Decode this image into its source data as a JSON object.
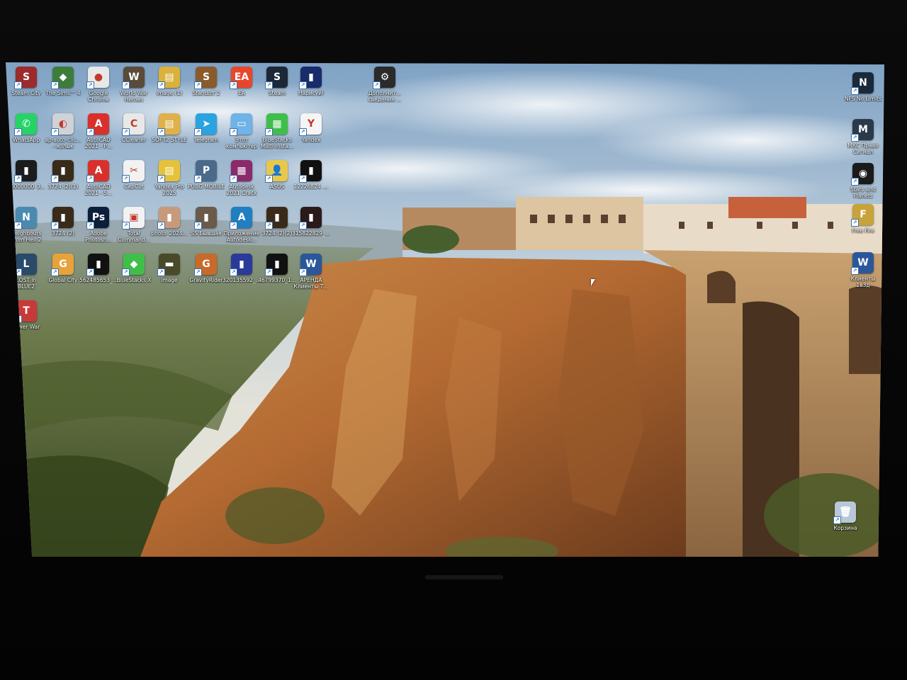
{
  "desktop": {
    "left_icons": [
      {
        "label": "Steam City",
        "color": "#9c2b2b",
        "glyph": "S"
      },
      {
        "label": "The Sims™ 4",
        "color": "#3d7d3b",
        "glyph": "◆"
      },
      {
        "label": "Google Chrome",
        "color": "#e8e8e8",
        "glyph": "●"
      },
      {
        "label": "World War Heroes",
        "color": "#5a4a3a",
        "glyph": "W"
      },
      {
        "label": "image (1)",
        "color": "#d9b13b",
        "glyph": "▤"
      },
      {
        "label": "Standoff 2",
        "color": "#8a5a2a",
        "glyph": "S"
      },
      {
        "label": "EA",
        "color": "#e8462b",
        "glyph": "EA"
      },
      {
        "label": "Steam",
        "color": "#1b2838",
        "glyph": "S"
      },
      {
        "label": "Нарисуй!",
        "color": "#1a2b6b",
        "glyph": "▮"
      },
      {
        "label": "WhatsApp",
        "color": "#25d366",
        "glyph": "✆"
      },
      {
        "label": "ap-auto-clic... - ярлык",
        "color": "#cfd3d6",
        "glyph": "◐"
      },
      {
        "label": "AutoCAD 2021 - Р...",
        "color": "#d9302b",
        "glyph": "A"
      },
      {
        "label": "CCleaner",
        "color": "#e8e8e8",
        "glyph": "C"
      },
      {
        "label": "SOFT2 STYLE",
        "color": "#e0b04a",
        "glyph": "▤"
      },
      {
        "label": "Telegram",
        "color": "#2aa3e0",
        "glyph": "➤"
      },
      {
        "label": "Этот компьютер",
        "color": "#6fb3e8",
        "glyph": "▭"
      },
      {
        "label": "BlueStacks Multi-Insta...",
        "color": "#3fbf4a",
        "glyph": "▦"
      },
      {
        "label": "Yandex",
        "color": "#f5f5f5",
        "glyph": "Y"
      },
      {
        "label": "10000000_3...",
        "color": "#1c1c1c",
        "glyph": "▮"
      },
      {
        "label": "3724 (2)(1)",
        "color": "#3a2a1a",
        "glyph": "▮"
      },
      {
        "label": "AutoCAD 2021 - S...",
        "color": "#d9302b",
        "glyph": "A"
      },
      {
        "label": "CapCut",
        "color": "#f2f2f2",
        "glyph": "✂"
      },
      {
        "label": "Yandex Pro 2025",
        "color": "#e6c23a",
        "glyph": "▤"
      },
      {
        "label": "PUBG MOBILE",
        "color": "#4a6a8a",
        "glyph": "P"
      },
      {
        "label": "Autodesk 2021 Crack",
        "color": "#8a2a6a",
        "glyph": "▦"
      },
      {
        "label": "ASUS",
        "color": "#e8c84a",
        "glyph": "👤"
      },
      {
        "label": "12226824_...",
        "color": "#111111",
        "glyph": "▮"
      },
      {
        "label": "Neighbours From Hell 2",
        "color": "#4a8ab0",
        "glyph": "N"
      },
      {
        "label": "3724 (2)",
        "color": "#3a2a1a",
        "glyph": "▮"
      },
      {
        "label": "Adobe Photosh...",
        "color": "#0b1f3a",
        "glyph": "Ps"
      },
      {
        "label": "Total Command...",
        "color": "#f2f2f2",
        "glyph": "▣"
      },
      {
        "label": "photo_2024...",
        "color": "#c89a7a",
        "glyph": "▮"
      },
      {
        "label": "SS Бывшая",
        "color": "#6a5a4a",
        "glyph": "▮"
      },
      {
        "label": "Приложение Autodesk...",
        "color": "#1f7fc0",
        "glyph": "A"
      },
      {
        "label": "3724 (2)(2)",
        "color": "#3a2a1a",
        "glyph": "▮"
      },
      {
        "label": "315822829_...",
        "color": "#2a1a1a",
        "glyph": "▮"
      },
      {
        "label": "LOST in BLUE2",
        "color": "#2a4a6a",
        "glyph": "L"
      },
      {
        "label": "Global City",
        "color": "#e8a23a",
        "glyph": "G"
      },
      {
        "label": "562485653_...",
        "color": "#111111",
        "glyph": "▮"
      },
      {
        "label": "BlueStacks X",
        "color": "#3fbf4a",
        "glyph": "◆"
      },
      {
        "label": "image",
        "color": "#4a4a2a",
        "glyph": "▬"
      },
      {
        "label": "GravityRider",
        "color": "#c86a2a",
        "glyph": "G"
      },
      {
        "label": "320135592_...",
        "color": "#2a3a9a",
        "glyph": "▮"
      },
      {
        "label": "46799370_1...",
        "color": "#111111",
        "glyph": "▮"
      },
      {
        "label": "АРЕНДА Клиенты Т...",
        "color": "#2b579a",
        "glyph": "W"
      },
      {
        "label": "Tower War",
        "color": "#c83a3a",
        "glyph": "T"
      }
    ],
    "middle_icon": {
      "label": "Дополнит... сведения ...",
      "color": "#2a2a2a",
      "glyph": "⚙"
    },
    "right_icons": [
      {
        "label": "NFS No Limits",
        "color": "#1a2a3a",
        "glyph": "N"
      },
      {
        "label": "МКС Право Сигнал",
        "color": "#2a3a4a",
        "glyph": "M"
      },
      {
        "label": "Stars and Planets",
        "color": "#1a1a1a",
        "glyph": "◉"
      },
      {
        "label": "Free Fire",
        "color": "#c8a23a",
        "glyph": "F"
      },
      {
        "label": "Клиенты 1в3д",
        "color": "#2b579a",
        "glyph": "W"
      }
    ],
    "recycle_bin": {
      "label": "Корзина",
      "color": "#b8c8d8",
      "glyph": "🗑"
    }
  }
}
